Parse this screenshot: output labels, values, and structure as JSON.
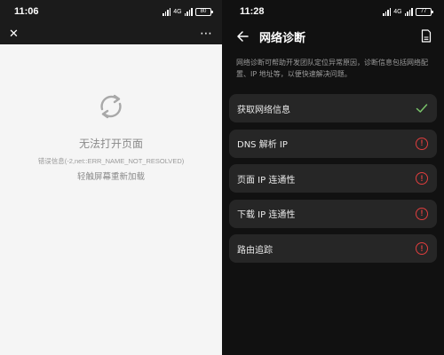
{
  "left_screen": {
    "status": {
      "time": "11:06",
      "network": "4G",
      "battery": "80"
    },
    "error": {
      "title": "无法打开页面",
      "code": "错误信息(-2,net::ERR_NAME_NOT_RESOLVED)",
      "hint": "轻触屏幕重新加载"
    }
  },
  "right_screen": {
    "status": {
      "time": "11:28",
      "network": "4G",
      "battery": "77"
    },
    "header": {
      "title": "网络诊断"
    },
    "description": "网络诊断可帮助开发团队定位异常原因，诊断信息包括网络配置、IP 地址等，以便快速解决问题。",
    "items": [
      {
        "label": "获取网络信息",
        "status": "ok"
      },
      {
        "label": "DNS 解析 IP",
        "status": "error"
      },
      {
        "label": "页面 IP 连通性",
        "status": "error"
      },
      {
        "label": "下载 IP 连通性",
        "status": "error"
      },
      {
        "label": "路由追踪",
        "status": "error"
      }
    ],
    "colors": {
      "ok": "#7ac46b",
      "error": "#e03e3e"
    },
    "error_glyph": "!"
  }
}
